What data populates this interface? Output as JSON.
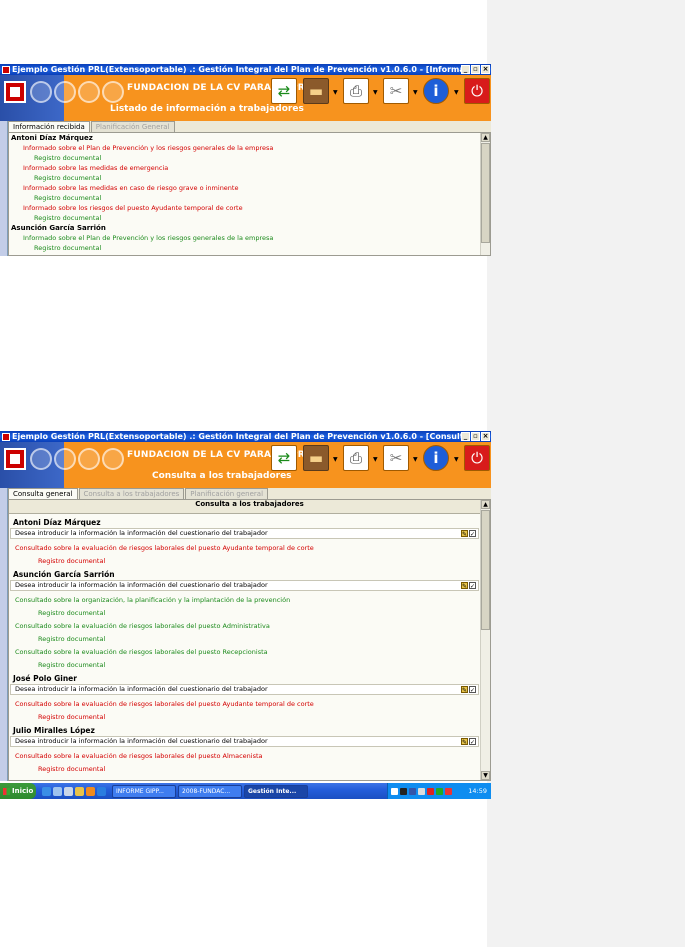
{
  "window1": {
    "title": "Ejemplo Gestión PRL(Extensoportable) .: Gestión Integral del Plan de Prevención v1.0.6.0 - [Información]",
    "foundation": "FUNDACION DE LA CV PARA LA PRL",
    "subtitle": "Listado de información a trabajadores",
    "tabs": [
      "Información recibida",
      "Planificación General"
    ],
    "people": [
      {
        "name": "Antoni Díaz Márquez",
        "items": [
          {
            "text": "Informado sobre el Plan de Prevención y los riesgos generales de la empresa",
            "color": "red",
            "doc": "Registro documental"
          },
          {
            "text": "Informado sobre las medidas de emergencia",
            "color": "red",
            "doc": "Registro documental"
          },
          {
            "text": "Informado sobre las medidas en caso de riesgo grave o inminente",
            "color": "red",
            "doc": "Registro documental"
          },
          {
            "text": "Informado sobre los riesgos del puesto Ayudante temporal de corte",
            "color": "red",
            "doc": "Registro documental"
          }
        ]
      },
      {
        "name": "Asunción García Sarrión",
        "items": [
          {
            "text": "Informado sobre el Plan de Prevención y los riesgos generales de la empresa",
            "color": "green",
            "doc": "Registro documental"
          }
        ]
      }
    ]
  },
  "window2": {
    "title": "Ejemplo Gestión PRL(Extensoportable) .: Gestión Integral del Plan de Prevención v1.0.6.0 - [Consulta a los trabajadores]",
    "foundation": "FUNDACION DE LA CV PARA LA PRL",
    "subtitle": "Consulta a los trabajadores",
    "tabs": [
      "Consulta general",
      "Consulta a los trabajadores",
      "Planificación general"
    ],
    "header": "Consulta a los trabajadores",
    "question": "Desea introducir la información la información del cuestionario del trabajador",
    "people": [
      {
        "name": "Antoni Díaz Márquez",
        "items": [
          {
            "text": "Consultado sobre la evaluación de riesgos laborales del puesto Ayudante temporal de corte",
            "color": "red",
            "doc": "Registro documental"
          }
        ]
      },
      {
        "name": "Asunción García Sarrión",
        "items": [
          {
            "text": "Consultado sobre la organización, la planificación y la implantación de la prevención",
            "color": "green",
            "doc": "Registro documental"
          },
          {
            "text": "Consultado sobre la evaluación de riesgos laborales del puesto Administrativa",
            "color": "green",
            "doc": "Registro documental"
          },
          {
            "text": "Consultado sobre la evaluación de riesgos laborales del puesto Recepcionista",
            "color": "green",
            "doc": "Registro documental"
          }
        ]
      },
      {
        "name": "José Polo Giner",
        "items": [
          {
            "text": "Consultado sobre la evaluación de riesgos laborales del puesto Ayudante temporal de corte",
            "color": "red",
            "doc": "Registro documental"
          }
        ]
      },
      {
        "name": "Julio Miralles López",
        "items": [
          {
            "text": "Consultado sobre la evaluación de riesgos laborales del puesto Almacenista",
            "color": "red",
            "doc": "Registro documental"
          }
        ]
      }
    ]
  },
  "taskbar": {
    "start": "Inicio",
    "tasks": [
      "INFORME GIPP...",
      "2008-FUNDAC...",
      "Gestión Inte..."
    ],
    "clock": "14:59"
  },
  "colors": {
    "orange": "#f7931e",
    "red": "#d40000",
    "green": "#1b8a1b",
    "titlebar": "#0a3fb8"
  }
}
